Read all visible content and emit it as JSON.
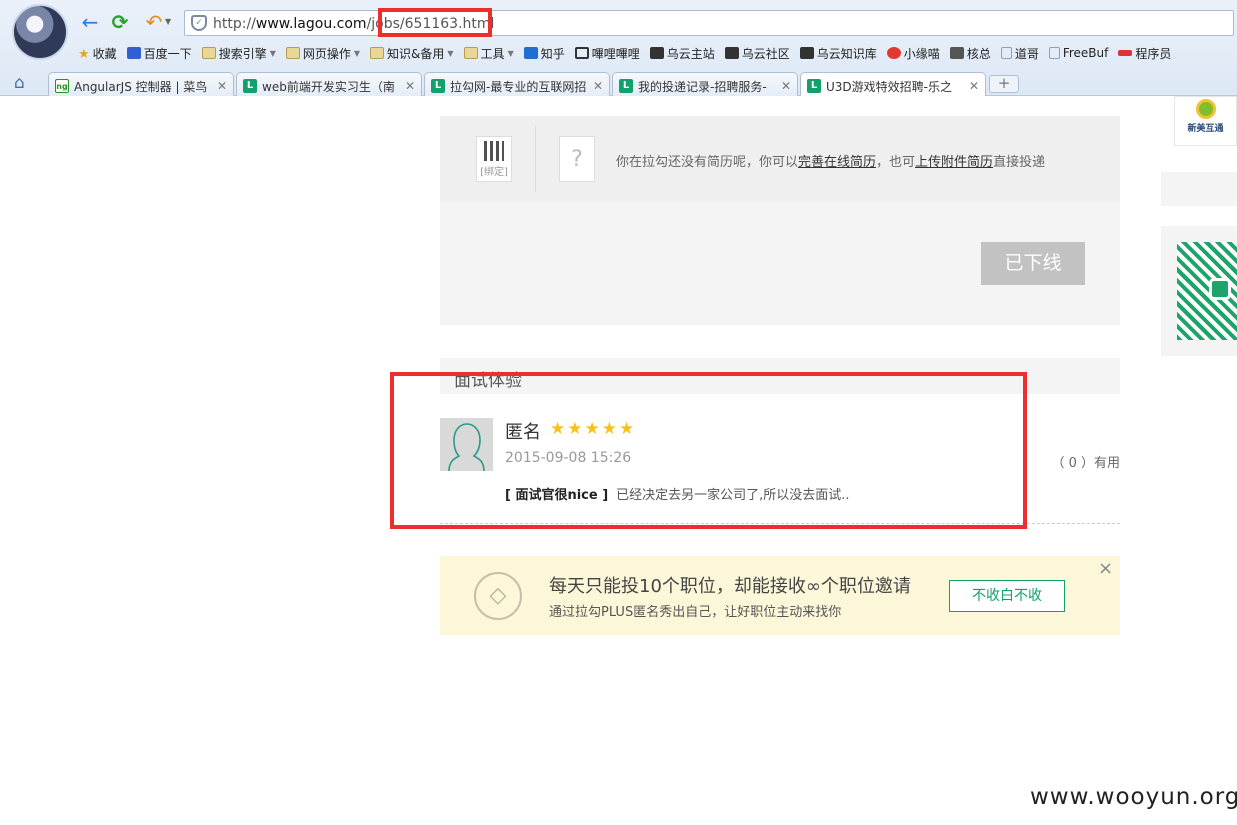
{
  "browser": {
    "url_prefix": "http://",
    "url_host": "www.lagou.com",
    "url_path": "/jobs/651163.html",
    "bookmarks": [
      {
        "label": "收藏",
        "icon": "star-icon"
      },
      {
        "label": "百度一下",
        "icon": "baidu-paw-icon"
      },
      {
        "label": "搜索引擎",
        "icon": "folder-icon",
        "menu": true
      },
      {
        "label": "网页操作",
        "icon": "folder-icon",
        "menu": true
      },
      {
        "label": "知识&备用",
        "icon": "folder-icon",
        "menu": true
      },
      {
        "label": "工具",
        "icon": "folder-icon",
        "menu": true
      },
      {
        "label": "知乎",
        "icon": "zhihu-icon"
      },
      {
        "label": "嗶哩嗶哩",
        "icon": "bilibili-icon"
      },
      {
        "label": "乌云主站",
        "icon": "wooyun-icon"
      },
      {
        "label": "乌云社区",
        "icon": "wooyun-icon"
      },
      {
        "label": "乌云知识库",
        "icon": "wooyun-icon"
      },
      {
        "label": "小缘喵",
        "icon": "weibo-icon"
      },
      {
        "label": "核总",
        "icon": "avatar-icon"
      },
      {
        "label": "道哥",
        "icon": "page-icon"
      },
      {
        "label": "FreeBuf",
        "icon": "page-icon"
      },
      {
        "label": "程序员",
        "icon": "pudn-icon"
      }
    ],
    "tabs": [
      {
        "title": "AngularJS 控制器 | 菜鸟",
        "icon": "angular-icon"
      },
      {
        "title": "web前端开发实习生（南",
        "icon": "lagou-icon"
      },
      {
        "title": "拉勾网-最专业的互联网招",
        "icon": "lagou-icon"
      },
      {
        "title": "我的投递记录-招聘服务-",
        "icon": "lagou-icon"
      },
      {
        "title": "U3D游戏特效招聘-乐之",
        "icon": "lagou-icon",
        "active": true
      }
    ],
    "new_tab_label": "+"
  },
  "apply": {
    "bind_label": "[绑定]",
    "resume_tip_before": "你在拉勾还没有简历呢，你可以",
    "resume_link_online": "完善在线简历",
    "resume_tip_middle": "，也可",
    "resume_link_upload": "上传附件简历",
    "resume_tip_after": "直接投递",
    "offline_button": "已下线"
  },
  "interview": {
    "header": "面试体验",
    "review": {
      "name": "匿名",
      "stars": "★★★★★",
      "rating": 5,
      "date": "2015-09-08 15:26",
      "useful": "（ 0 ）有用",
      "tag": "[ 面试官很nice ]",
      "content": "已经决定去另一家公司了,所以没去面试.."
    }
  },
  "plus_banner": {
    "title": "每天只能投10个职位，却能接收∞个职位邀请",
    "subtitle": "通过拉勾PLUS匿名秀出自己，让好职位主动来找你",
    "button": "不收白不收",
    "close": "×"
  },
  "sidebar": {
    "logo_text": "新美互通"
  },
  "watermark": "www.wooyun.org",
  "colors": {
    "lagou_green": "#12a06b",
    "highlight_red": "#ee2d2d",
    "star_yellow": "#f7c21b"
  }
}
